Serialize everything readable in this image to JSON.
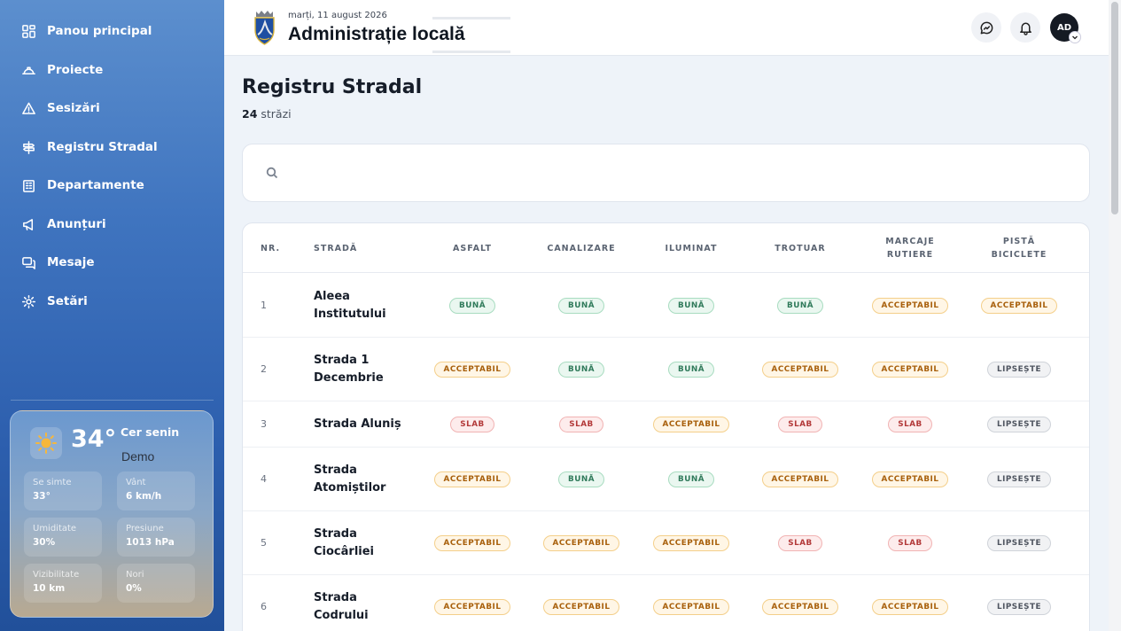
{
  "sidebar": {
    "items": [
      {
        "label": "Panou principal",
        "icon": "dashboard-icon"
      },
      {
        "label": "Proiecte",
        "icon": "helmet-icon"
      },
      {
        "label": "Sesizări",
        "icon": "warning-icon"
      },
      {
        "label": "Registru Stradal",
        "icon": "signpost-icon"
      },
      {
        "label": "Departamente",
        "icon": "building-icon"
      },
      {
        "label": "Anunțuri",
        "icon": "megaphone-icon"
      },
      {
        "label": "Mesaje",
        "icon": "messages-icon"
      },
      {
        "label": "Setări",
        "icon": "gear-icon"
      }
    ],
    "weather": {
      "temperature": "34°",
      "condition": "Cer senin",
      "demo": "Demo",
      "icon": "sun-icon",
      "stats": [
        {
          "label": "Se simte",
          "value": "33°"
        },
        {
          "label": "Vânt",
          "value": "6 km/h"
        },
        {
          "label": "Umiditate",
          "value": "30%"
        },
        {
          "label": "Presiune",
          "value": "1013 hPa"
        },
        {
          "label": "Vizibilitate",
          "value": "10 km"
        },
        {
          "label": "Nori",
          "value": "0%"
        }
      ]
    }
  },
  "header": {
    "date": "marți, 11 august 2026",
    "title": "Administrație locală",
    "avatar": "AD"
  },
  "page": {
    "title": "Registru Stradal",
    "count": "24",
    "count_label": " străzi",
    "search_placeholder": ""
  },
  "table": {
    "headers": {
      "nr": "NR.",
      "street": "STRADĂ",
      "asfalt": "ASFALT",
      "canalizare": "CANALIZARE",
      "iluminat": "ILUMINAT",
      "trotuar": "TROTUAR",
      "marcaje": "MARCAJE RUTIERE",
      "pista": "PISTĂ BICICLETE"
    },
    "rows": [
      {
        "nr": "1",
        "street": "Aleea Institutului",
        "values": [
          "BUNĂ",
          "BUNĂ",
          "BUNĂ",
          "BUNĂ",
          "ACCEPTABIL",
          "ACCEPTABIL"
        ]
      },
      {
        "nr": "2",
        "street": "Strada 1 Decembrie",
        "values": [
          "ACCEPTABIL",
          "BUNĂ",
          "BUNĂ",
          "ACCEPTABIL",
          "ACCEPTABIL",
          "LIPSEȘTE"
        ]
      },
      {
        "nr": "3",
        "street": "Strada Aluniș",
        "values": [
          "SLAB",
          "SLAB",
          "ACCEPTABIL",
          "SLAB",
          "SLAB",
          "LIPSEȘTE"
        ]
      },
      {
        "nr": "4",
        "street": "Strada Atomiștilor",
        "values": [
          "ACCEPTABIL",
          "BUNĂ",
          "BUNĂ",
          "ACCEPTABIL",
          "ACCEPTABIL",
          "LIPSEȘTE"
        ]
      },
      {
        "nr": "5",
        "street": "Strada Ciocârliei",
        "values": [
          "ACCEPTABIL",
          "ACCEPTABIL",
          "ACCEPTABIL",
          "SLAB",
          "SLAB",
          "LIPSEȘTE"
        ]
      },
      {
        "nr": "6",
        "street": "Strada Codrului",
        "values": [
          "ACCEPTABIL",
          "ACCEPTABIL",
          "ACCEPTABIL",
          "ACCEPTABIL",
          "ACCEPTABIL",
          "LIPSEȘTE"
        ]
      }
    ]
  },
  "colors": {
    "sidebar": "#3f74bf",
    "good": "#2f7a5a",
    "acceptable": "#a8600c",
    "poor": "#b33a3a",
    "missing": "#4f5560"
  }
}
